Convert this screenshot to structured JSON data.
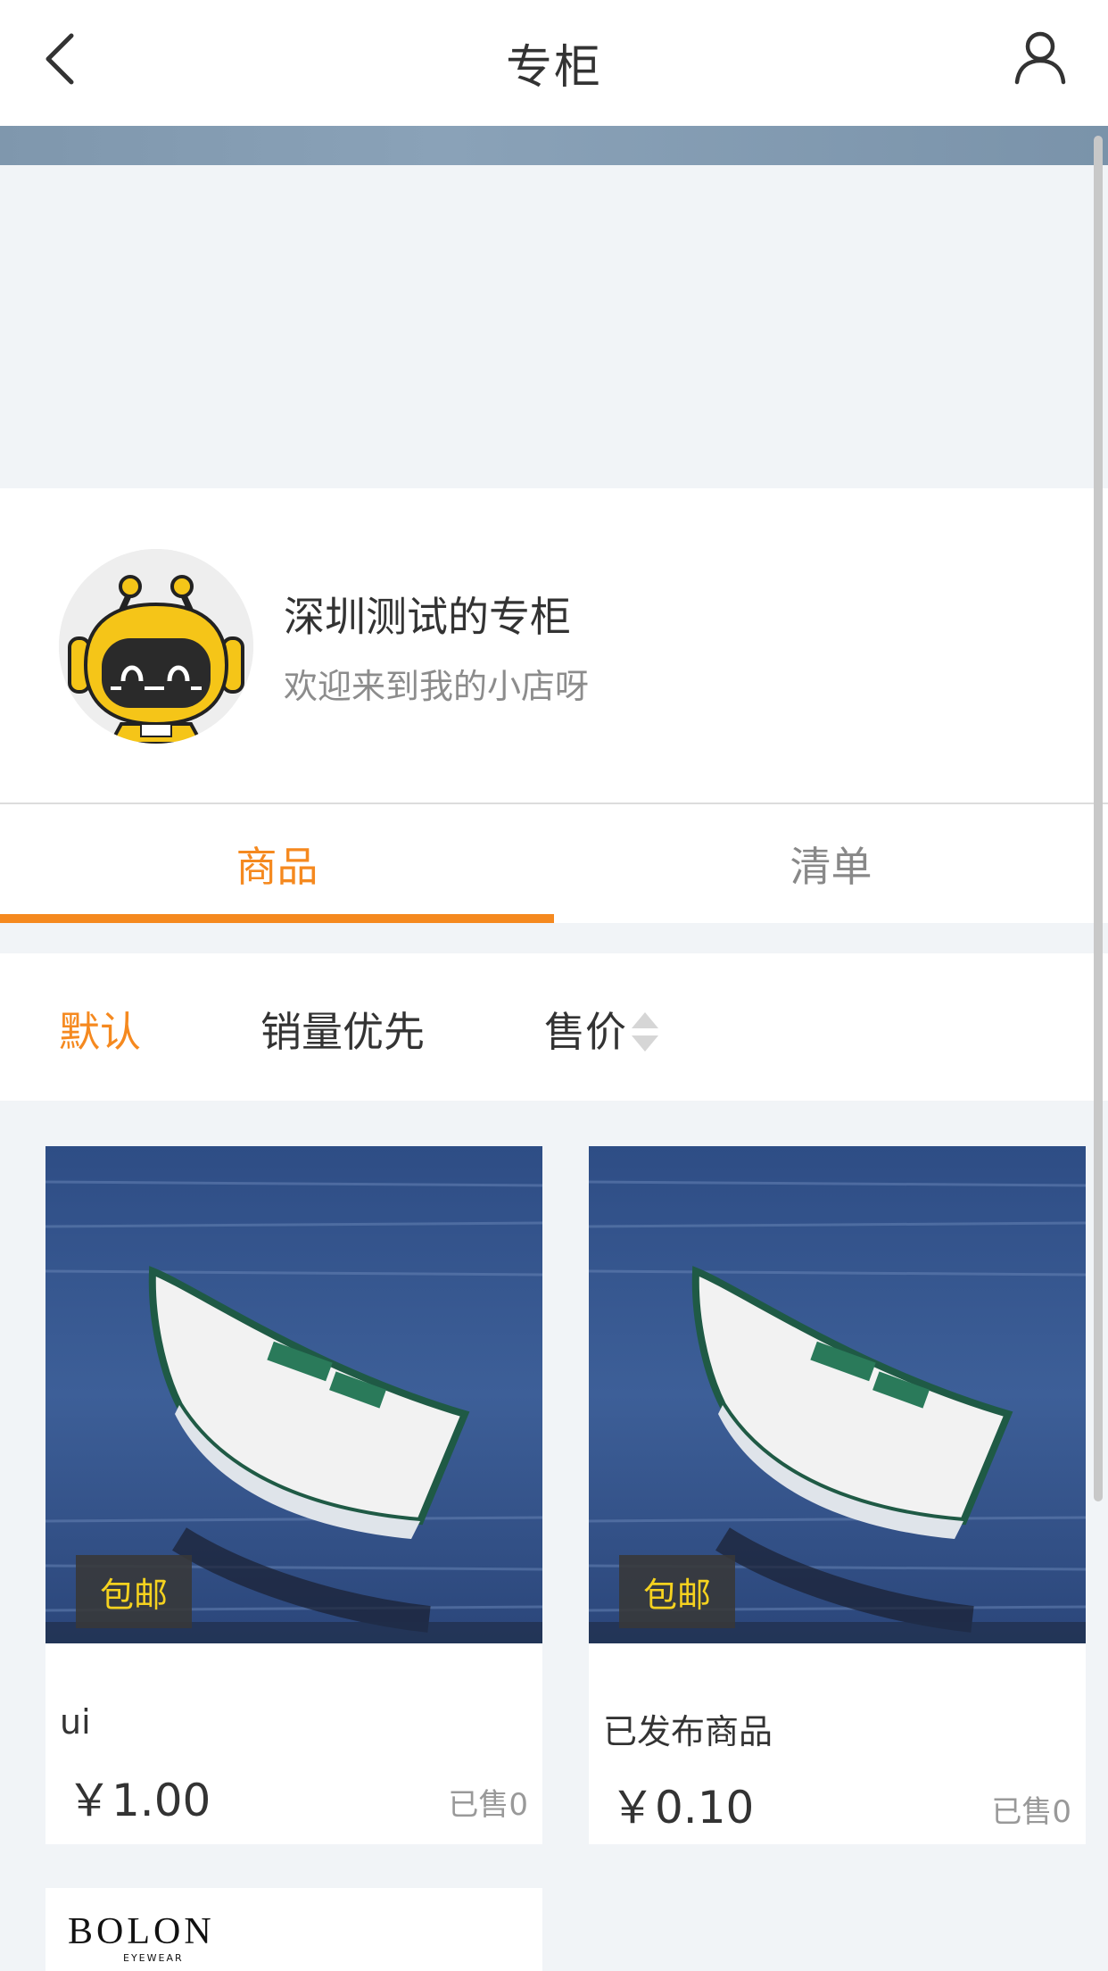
{
  "header": {
    "title": "专柜"
  },
  "shop": {
    "name": "深圳测试的专柜",
    "description": "欢迎来到我的小店呀"
  },
  "tabs": [
    {
      "label": "商品",
      "active": true
    },
    {
      "label": "清单",
      "active": false
    }
  ],
  "sort": {
    "default_label": "默认",
    "sales_label": "销量优先",
    "price_label": "售价"
  },
  "products": [
    {
      "badge": "包邮",
      "name": "ui",
      "price": "￥1.00",
      "sold": "已售0"
    },
    {
      "badge": "包邮",
      "name": "已发布商品",
      "price": "￥0.10",
      "sold": "已售0"
    }
  ],
  "third_product": {
    "brand": "BOLON",
    "brand_sub": "EYEWEAR"
  },
  "colors": {
    "accent": "#f5891f",
    "badge_text": "#f5d21f"
  }
}
